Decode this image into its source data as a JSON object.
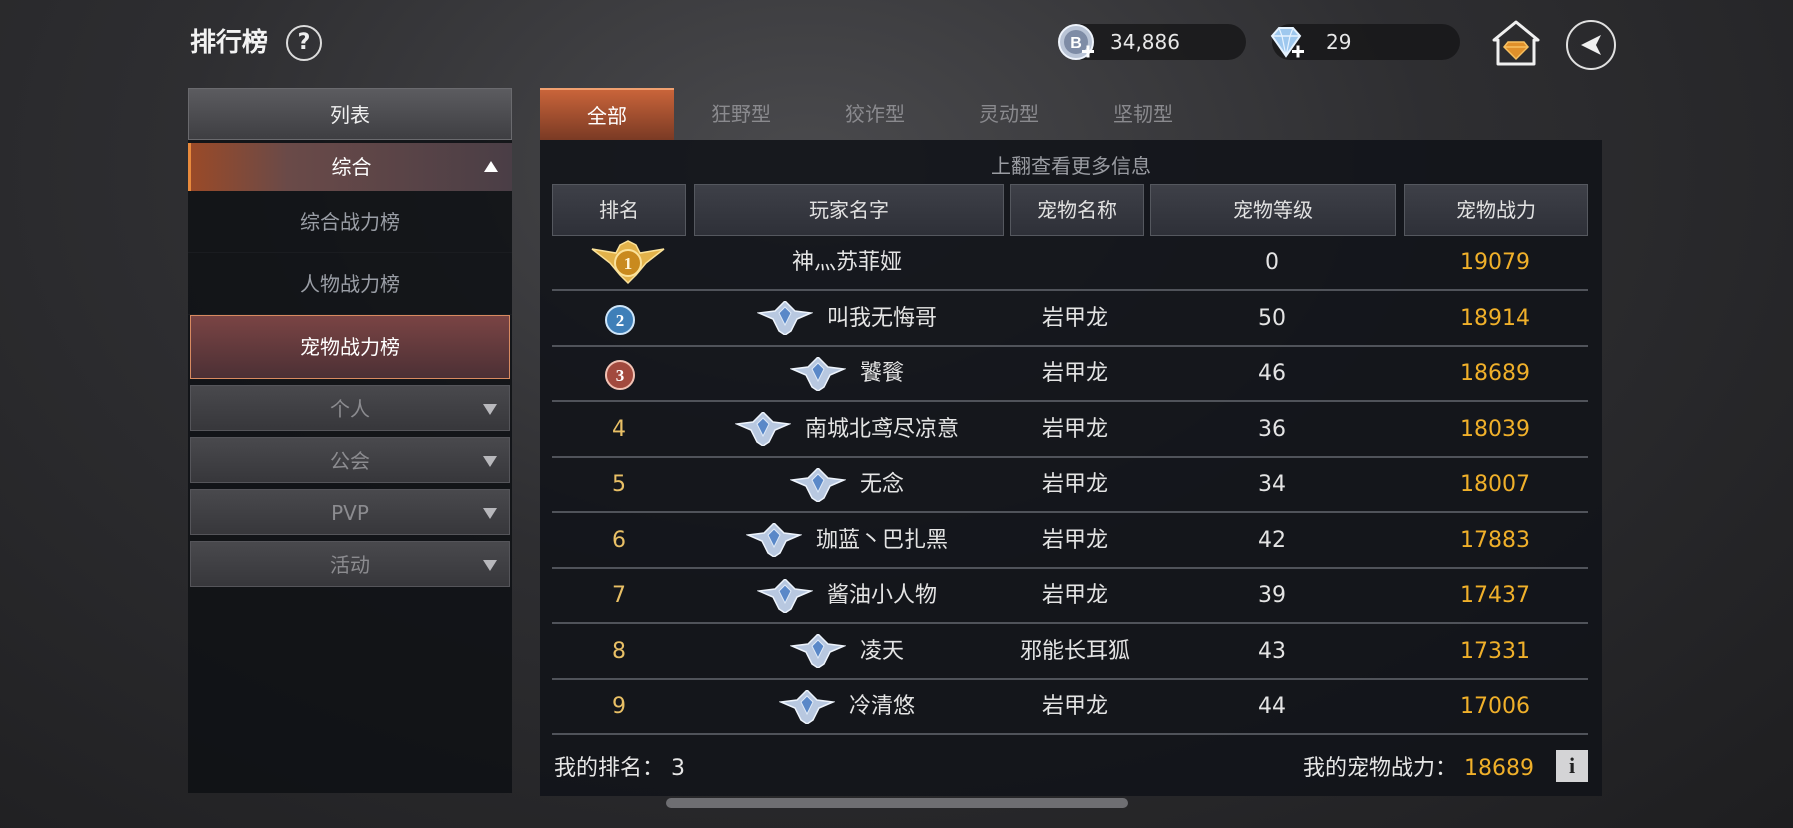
{
  "header": {
    "title": "排行榜",
    "help": "?",
    "gold": "34,886",
    "gems": "29"
  },
  "sidebar": {
    "heading": "列表",
    "active_category": "综合",
    "items": [
      "综合战力榜",
      "人物战力榜",
      "宠物战力榜"
    ],
    "active_item": "宠物战力榜",
    "sub_categories": [
      "个人",
      "公会",
      "PVP",
      "活动"
    ]
  },
  "tabs": [
    "全部",
    "狂野型",
    "狡诈型",
    "灵动型",
    "坚韧型"
  ],
  "table": {
    "hint": "上翻查看更多信息",
    "headers": [
      "排名",
      "玩家名字",
      "宠物名称",
      "宠物等级",
      "宠物战力"
    ],
    "rows": [
      {
        "rank": "1",
        "name": "神灬苏菲娅",
        "pet": "",
        "level": "0",
        "power": "19079"
      },
      {
        "rank": "2",
        "name": "叫我无悔哥",
        "pet": "岩甲龙",
        "level": "50",
        "power": "18914"
      },
      {
        "rank": "3",
        "name": "饕餮",
        "pet": "岩甲龙",
        "level": "46",
        "power": "18689"
      },
      {
        "rank": "4",
        "name": "南城北鸢尽凉意",
        "pet": "岩甲龙",
        "level": "36",
        "power": "18039"
      },
      {
        "rank": "5",
        "name": "无念",
        "pet": "岩甲龙",
        "level": "34",
        "power": "18007"
      },
      {
        "rank": "6",
        "name": "珈蓝丶巴扎黑",
        "pet": "岩甲龙",
        "level": "42",
        "power": "17883"
      },
      {
        "rank": "7",
        "name": "酱油小人物",
        "pet": "岩甲龙",
        "level": "39",
        "power": "17437"
      },
      {
        "rank": "8",
        "name": "凌天",
        "pet": "邪能长耳狐",
        "level": "43",
        "power": "17331"
      },
      {
        "rank": "9",
        "name": "冷清悠",
        "pet": "岩甲龙",
        "level": "44",
        "power": "17006"
      }
    ]
  },
  "footer": {
    "my_rank_label": "我的排名：",
    "my_rank": "3",
    "my_power_label": "我的宠物战力：",
    "my_power": "18689",
    "info": "i"
  },
  "icons": {
    "gold": "gold-coin-icon",
    "gem": "diamond-icon",
    "home": "mail-home-icon",
    "back": "back-arrow-icon",
    "rank_badge": "wing-badge-icon"
  },
  "colors": {
    "accent": "#c9643a",
    "power": "#f0b02a",
    "rank": "#e9c066"
  }
}
